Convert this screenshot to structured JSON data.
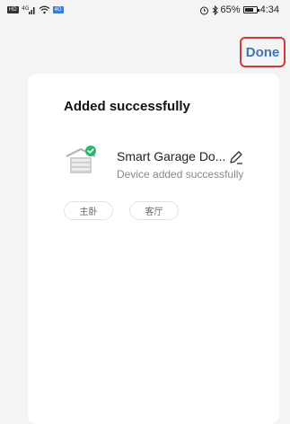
{
  "status_bar": {
    "left_chips": [
      "HD",
      "4G"
    ],
    "right_text": "65%",
    "time": "4:34",
    "icons": [
      "signal-icon",
      "wifi-icon",
      "alarm-icon",
      "bluetooth-icon",
      "battery-icon"
    ]
  },
  "header": {
    "done_label": "Done"
  },
  "card": {
    "title": "Added successfully",
    "device": {
      "name": "Smart Garage Do...",
      "status": "Device added successfully",
      "icon": "garage-door-icon"
    },
    "rooms": [
      "主卧",
      "客厅"
    ]
  },
  "colors": {
    "accent": "#3f73b6",
    "highlight_border": "#d43a3a",
    "success": "#2bb673",
    "background": "#f4f4f4"
  }
}
